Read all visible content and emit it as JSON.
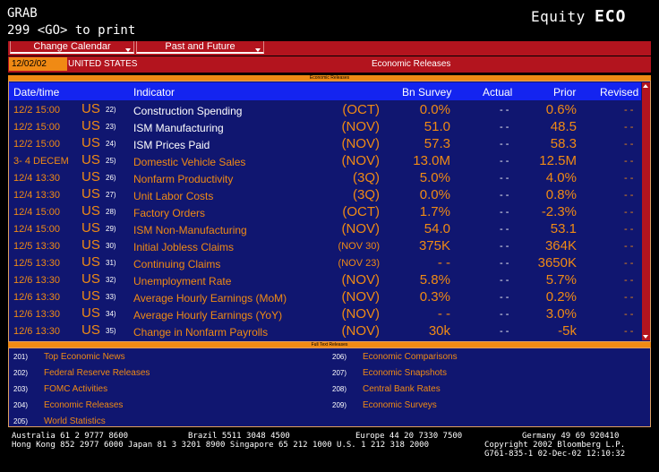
{
  "header": {
    "grab": "GRAB",
    "go_line": "299 <GO> to print",
    "equity_label": "Equity",
    "function_code": "ECO"
  },
  "menu": {
    "change_calendar": "Change Calendar",
    "past_and_future": "Past and Future"
  },
  "controls": {
    "date_value": "12/02/02",
    "country": "UNITED STATES",
    "title": "Economic Releases"
  },
  "stripes": {
    "top": "Economic Releases",
    "middle": "Full Text Releases"
  },
  "table": {
    "columns": [
      "Date/time",
      "Indicator",
      "Bn Survey",
      "Actual",
      "Prior",
      "Revised"
    ],
    "rows": [
      {
        "date": "12/2 15:00",
        "country": "US",
        "num": "22)",
        "indicator": "Construction Spending",
        "period": "(OCT)",
        "survey": "0.0%",
        "actual": "- -",
        "prior": "0.6%",
        "revised": "- -",
        "highlight": true
      },
      {
        "date": "12/2 15:00",
        "country": "US",
        "num": "23)",
        "indicator": "ISM Manufacturing",
        "period": "(NOV)",
        "survey": "51.0",
        "actual": "- -",
        "prior": "48.5",
        "revised": "- -",
        "highlight": true
      },
      {
        "date": "12/2 15:00",
        "country": "US",
        "num": "24)",
        "indicator": "ISM Prices Paid",
        "period": "(NOV)",
        "survey": "57.3",
        "actual": "- -",
        "prior": "58.3",
        "revised": "- -",
        "highlight": true
      },
      {
        "date": "3- 4 DECEM",
        "country": "US",
        "num": "25)",
        "indicator": "Domestic Vehicle Sales",
        "period": "(NOV)",
        "survey": "13.0M",
        "actual": "- -",
        "prior": "12.5M",
        "revised": "- -",
        "highlight": false
      },
      {
        "date": "12/4 13:30",
        "country": "US",
        "num": "26)",
        "indicator": "Nonfarm Productivity",
        "period": "(3Q)",
        "survey": "5.0%",
        "actual": "- -",
        "prior": "4.0%",
        "revised": "- -",
        "highlight": false
      },
      {
        "date": "12/4 13:30",
        "country": "US",
        "num": "27)",
        "indicator": "Unit Labor Costs",
        "period": "(3Q)",
        "survey": "0.0%",
        "actual": "- -",
        "prior": "0.8%",
        "revised": "- -",
        "highlight": false
      },
      {
        "date": "12/4 15:00",
        "country": "US",
        "num": "28)",
        "indicator": "Factory Orders",
        "period": "(OCT)",
        "survey": "1.7%",
        "actual": "- -",
        "prior": "-2.3%",
        "revised": "- -",
        "highlight": false
      },
      {
        "date": "12/4 15:00",
        "country": "US",
        "num": "29)",
        "indicator": "ISM Non-Manufacturing",
        "period": "(NOV)",
        "survey": "54.0",
        "actual": "- -",
        "prior": "53.1",
        "revised": "- -",
        "highlight": false
      },
      {
        "date": "12/5 13:30",
        "country": "US",
        "num": "30)",
        "indicator": "Initial Jobless Claims",
        "period": "(NOV 30)",
        "survey": "375K",
        "actual": "- -",
        "prior": "364K",
        "revised": "- -",
        "highlight": false
      },
      {
        "date": "12/5 13:30",
        "country": "US",
        "num": "31)",
        "indicator": "Continuing Claims",
        "period": "(NOV 23)",
        "survey": "- -",
        "actual": "- -",
        "prior": "3650K",
        "revised": "- -",
        "highlight": false
      },
      {
        "date": "12/6 13:30",
        "country": "US",
        "num": "32)",
        "indicator": "Unemployment Rate",
        "period": "(NOV)",
        "survey": "5.8%",
        "actual": "- -",
        "prior": "5.7%",
        "revised": "- -",
        "highlight": false
      },
      {
        "date": "12/6 13:30",
        "country": "US",
        "num": "33)",
        "indicator": "Average Hourly Earnings    (MoM)",
        "period": "(NOV)",
        "survey": "0.3%",
        "actual": "- -",
        "prior": "0.2%",
        "revised": "- -",
        "highlight": false
      },
      {
        "date": "12/6 13:30",
        "country": "US",
        "num": "34)",
        "indicator": "Average Hourly Earnings    (YoY)",
        "period": "(NOV)",
        "survey": "- -",
        "actual": "- -",
        "prior": "3.0%",
        "revised": "- -",
        "highlight": false
      },
      {
        "date": "12/6 13:30",
        "country": "US",
        "num": "35)",
        "indicator": "Change in Nonfarm Payrolls",
        "period": "(NOV)",
        "survey": "30k",
        "actual": "- -",
        "prior": "-5k",
        "revised": "- -",
        "highlight": false
      }
    ]
  },
  "functions": {
    "left": [
      {
        "num": "201)",
        "label": "Top Economic News"
      },
      {
        "num": "202)",
        "label": "Federal Reserve Releases"
      },
      {
        "num": "203)",
        "label": "FOMC Activities"
      },
      {
        "num": "204)",
        "label": "Economic Releases"
      },
      {
        "num": "205)",
        "label": "World Statistics"
      }
    ],
    "right": [
      {
        "num": "206)",
        "label": "Economic Comparisons"
      },
      {
        "num": "207)",
        "label": "Economic Snapshots"
      },
      {
        "num": "208)",
        "label": "Central Bank Rates"
      },
      {
        "num": "209)",
        "label": "Economic Surveys"
      }
    ]
  },
  "footer": {
    "line1_a": "Australia 61 2 9777 8600",
    "line1_b": "Brazil 5511 3048 4500",
    "line1_c": "Europe 44 20 7330 7500",
    "line1_d": "Germany 49 69 920410",
    "line2_a": "Hong Kong 852 2977 6000 Japan 81 3 3201 8900 Singapore 65 212 1000 U.S. 1 212 318 2000",
    "line2_b": "Copyright 2002 Bloomberg L.P.",
    "line3": "G761-835-1 02-Dec-02 12:10:32"
  },
  "colors": {
    "background": "#000000",
    "panel": "#101670",
    "header_bar": "#1424f0",
    "bar_red": "#b3141e",
    "accent_orange": "#f08a14"
  }
}
